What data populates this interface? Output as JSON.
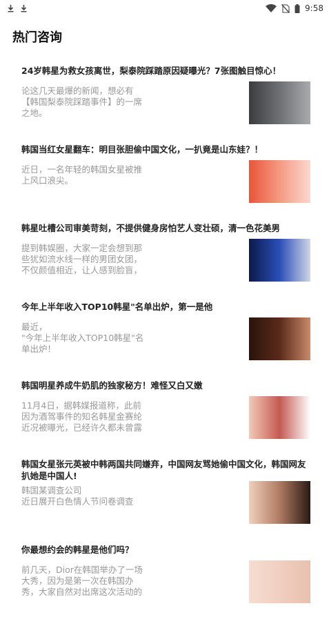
{
  "status_bar": {
    "left_icons": [
      "download-icon",
      "download-icon"
    ],
    "right_icons": [
      "wifi-icon",
      "no-sim-icon",
      "battery-icon"
    ],
    "time": "9:58"
  },
  "page": {
    "title": "热门咨询"
  },
  "news": [
    {
      "title": "24岁韩星为救女孩离世，梨泰院踩踏原因疑曝光？7张图触目惊心！",
      "summary": "论这几天最爆的新闻，想必有\n【韩国梨泰院踩踏事件】的一席\n之地。",
      "thumb_colors": [
        "#3a3c40",
        "#6e7074",
        "#a8aaae"
      ]
    },
    {
      "title": "韩国当红女星翻车：明目张胆偷中国文化，一扒竟是山东娃？！",
      "summary": "近日，一名年轻的韩国女星被推\n上风口浪尖。",
      "thumb_colors": [
        "#e8553a",
        "#f49a82",
        "#fbd8cf"
      ]
    },
    {
      "title": "韩星吐槽公司审美苛刻，不提供健身房怕艺人变壮硕，清一色花美男",
      "summary": "提到韩娱圈，大家一定会想到那\n些犹如流水线一样的男团女团，\n不仅颜值相近，让人感到脸盲，",
      "thumb_colors": [
        "#0c1a4a",
        "#2b4fb8",
        "#cfd6e6"
      ]
    },
    {
      "title": "今年上半年收入TOP10韩星\"名单出炉，第一是他",
      "summary": "最近，\n\"今年上半年收入TOP10韩星\"名\n单出炉！",
      "thumb_colors": [
        "#2a130c",
        "#5a2a1a",
        "#c98a6a"
      ]
    },
    {
      "title": "韩国明星养成牛奶肌的独家秘方！难怪又白又嫩",
      "summary": "11月4日，据韩媒报道称，此前\n因为酒驾事件的知名韩星金赛纶\n近况被曝光，已经许久都未曾露",
      "thumb_colors": [
        "#f2c9b8",
        "#c45a52",
        "#ffffff"
      ]
    },
    {
      "title": "韩国女星张元英被中韩两国共同嫌弃，中国网友骂她偷中国文化，韩国网友扒她是中国人!",
      "summary": "韩国某调查公司\n近日展开白色情人节问卷调查",
      "thumb_colors": [
        "#f0d0bd",
        "#b07a62",
        "#2a1a14"
      ],
      "tall": true
    },
    {
      "title": "你最想约会的韩星是他们吗？",
      "summary": "前几天，Dior在韩国举办了一场\n大秀，因为是第一次在韩国办\n秀，大家自然对出席这次活动的",
      "thumb_colors": [
        "#f6ddd0",
        "#f0cfc0",
        "#e8c0ae"
      ]
    }
  ]
}
